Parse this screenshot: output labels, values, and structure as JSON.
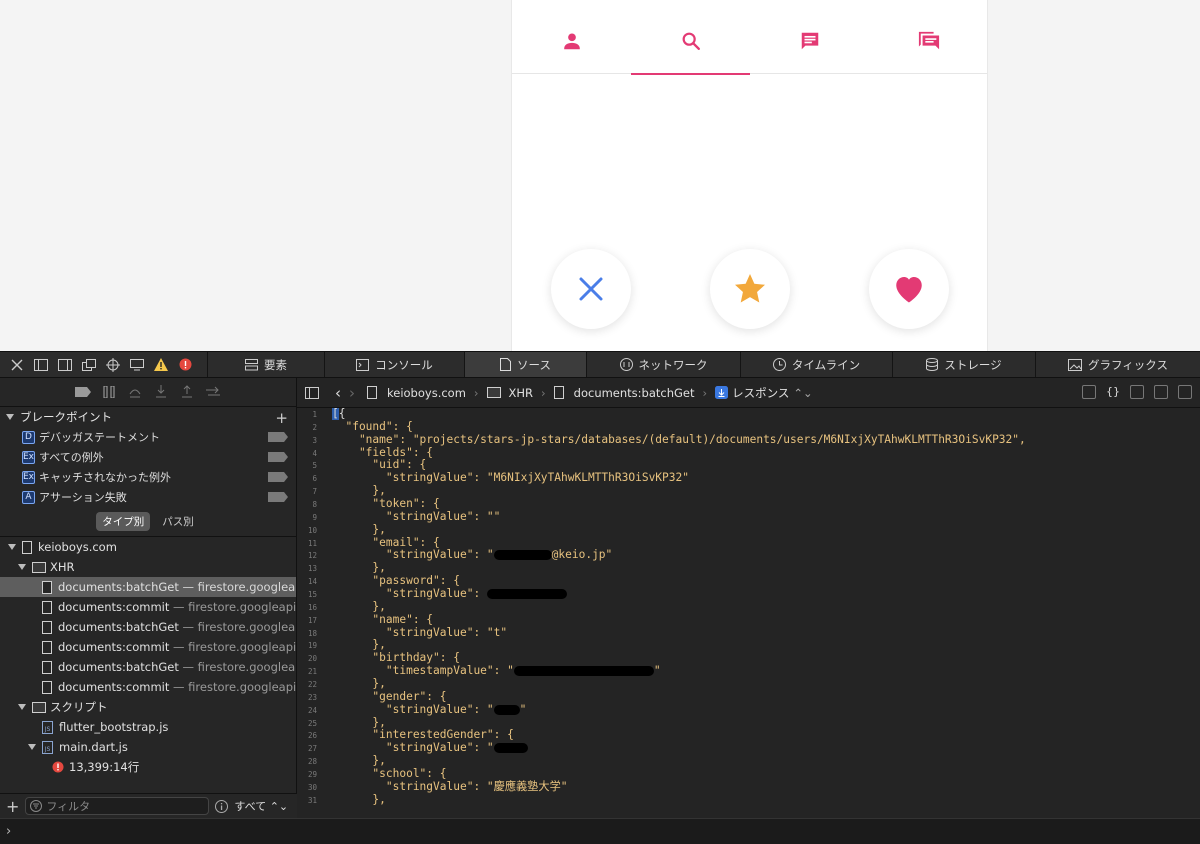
{
  "app": {
    "tabs": [
      {
        "name": "tab-profile",
        "icon": "person-icon",
        "active": false
      },
      {
        "name": "tab-search",
        "icon": "search-icon",
        "active": true
      },
      {
        "name": "tab-message",
        "icon": "message-icon",
        "active": false
      },
      {
        "name": "tab-chat",
        "icon": "chat-icon",
        "active": false
      }
    ],
    "actions": [
      "close-icon",
      "star-icon",
      "heart-icon"
    ],
    "accent": "#e33a74",
    "star_color": "#f2a83b",
    "close_color": "#4a7ee8"
  },
  "devtools": {
    "tabs": [
      {
        "label": "要素",
        "icon": "elements-icon"
      },
      {
        "label": "コンソール",
        "icon": "console-icon"
      },
      {
        "label": "ソース",
        "icon": "source-icon",
        "active": true
      },
      {
        "label": "ネットワーク",
        "icon": "network-icon"
      },
      {
        "label": "タイムライン",
        "icon": "timeline-icon"
      },
      {
        "label": "ストレージ",
        "icon": "storage-icon"
      },
      {
        "label": "グラフィックス",
        "icon": "graphics-icon"
      }
    ],
    "breakpoints": {
      "title": "ブレークポイント",
      "items": [
        {
          "badge": "D",
          "label": "デバッガステートメント"
        },
        {
          "badge": "Ex",
          "label": "すべての例外"
        },
        {
          "badge": "Ex",
          "label": "キャッチされなかった例外"
        },
        {
          "badge": "A",
          "label": "アサーション失敗"
        }
      ]
    },
    "segment": {
      "by_type": "タイプ別",
      "by_path": "パス別"
    },
    "tree": {
      "domain": "keioboys.com",
      "xhr_folder": "XHR",
      "xhr_items": [
        {
          "name": "documents:batchGet",
          "host": "— firestore.googleapi..."
        },
        {
          "name": "documents:commit",
          "host": "— firestore.googleapis...."
        },
        {
          "name": "documents:batchGet",
          "host": "— firestore.googleapi..."
        },
        {
          "name": "documents:commit",
          "host": "— firestore.googleapis...."
        },
        {
          "name": "documents:batchGet",
          "host": "— firestore.googleapi..."
        },
        {
          "name": "documents:commit",
          "host": "— firestore.googleapis...."
        }
      ],
      "script_folder": "スクリプト",
      "script_items": [
        "flutter_bootstrap.js",
        "main.dart.js"
      ],
      "error_line": "13,399:14行"
    },
    "filter": {
      "placeholder": "フィルタ",
      "scope": "すべて"
    },
    "path": {
      "domain": "keioboys.com",
      "folder": "XHR",
      "file": "documents:batchGet",
      "view": "レスポンス"
    },
    "code_lines": [
      "[{",
      "  \"found\": {",
      "    \"name\": \"projects/stars-jp-stars/databases/(default)/documents/users/M6NIxjXyTAhwKLMTThR3OiSvKP32\",",
      "    \"fields\": {",
      "      \"uid\": {",
      "        \"stringValue\": \"M6NIxjXyTAhwKLMTThR3OiSvKP32\"",
      "      },",
      "      \"token\": {",
      "        \"stringValue\": \"\"",
      "      },",
      "      \"email\": {",
      "        \"stringValue\": \"@keio.jp\"",
      "      },",
      "      \"password\": {",
      "        \"stringValue\": ",
      "      },",
      "      \"name\": {",
      "        \"stringValue\": \"t\"",
      "      },",
      "      \"birthday\": {",
      "        \"timestampValue\": \"\"",
      "      },",
      "      \"gender\": {",
      "        \"stringValue\": \"\"",
      "      },",
      "      \"interestedGender\": {",
      "        \"stringValue\": \"",
      "      },",
      "      \"school\": {",
      "        \"stringValue\": \"慶應義塾大学\"",
      "      },"
    ]
  }
}
